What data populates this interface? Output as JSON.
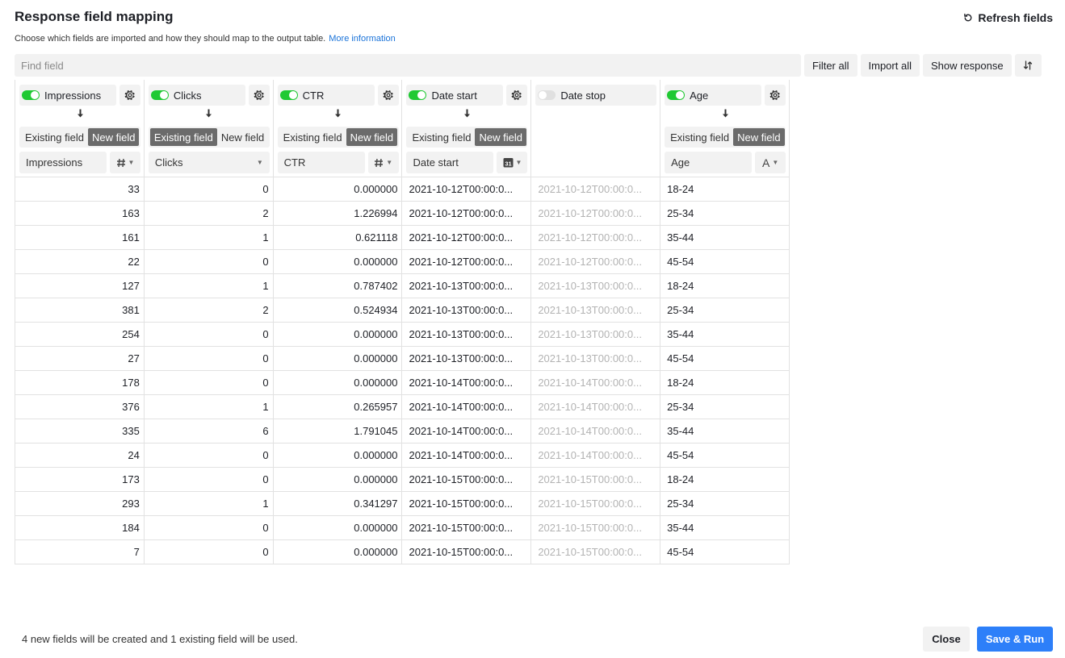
{
  "header": {
    "title": "Response field mapping",
    "refresh_label": "Refresh fields",
    "subtitle": "Choose which fields are imported and how they should map to the output table.",
    "more_info_link": "More information"
  },
  "toolbar": {
    "find_placeholder": "Find field",
    "filter_all": "Filter all",
    "import_all": "Import all",
    "show_response": "Show response"
  },
  "columns": [
    {
      "name": "Impressions",
      "enabled": true,
      "mapping": "new",
      "target": "Impressions",
      "type_icon": "hash-icon",
      "align": "right"
    },
    {
      "name": "Clicks",
      "enabled": true,
      "mapping": "existing",
      "target": "Clicks",
      "type_icon": "",
      "align": "right"
    },
    {
      "name": "CTR",
      "enabled": true,
      "mapping": "new",
      "target": "CTR",
      "type_icon": "hash-icon",
      "align": "right"
    },
    {
      "name": "Date start",
      "enabled": true,
      "mapping": "new",
      "target": "Date start",
      "type_icon": "calendar-icon",
      "align": "left"
    },
    {
      "name": "Date stop",
      "enabled": false,
      "mapping": "",
      "target": "",
      "type_icon": "",
      "align": "left"
    },
    {
      "name": "Age",
      "enabled": true,
      "mapping": "new",
      "target": "Age",
      "type_icon": "text-type-icon",
      "align": "left"
    }
  ],
  "mapping_labels": {
    "existing": "Existing field",
    "new": "New field"
  },
  "text_type_glyph": "A",
  "calendar_glyph": "31",
  "rows": [
    [
      "33",
      "0",
      "0.000000",
      "2021-10-12T00:00:0...",
      "2021-10-12T00:00:0...",
      "18-24"
    ],
    [
      "163",
      "2",
      "1.226994",
      "2021-10-12T00:00:0...",
      "2021-10-12T00:00:0...",
      "25-34"
    ],
    [
      "161",
      "1",
      "0.621118",
      "2021-10-12T00:00:0...",
      "2021-10-12T00:00:0...",
      "35-44"
    ],
    [
      "22",
      "0",
      "0.000000",
      "2021-10-12T00:00:0...",
      "2021-10-12T00:00:0...",
      "45-54"
    ],
    [
      "127",
      "1",
      "0.787402",
      "2021-10-13T00:00:0...",
      "2021-10-13T00:00:0...",
      "18-24"
    ],
    [
      "381",
      "2",
      "0.524934",
      "2021-10-13T00:00:0...",
      "2021-10-13T00:00:0...",
      "25-34"
    ],
    [
      "254",
      "0",
      "0.000000",
      "2021-10-13T00:00:0...",
      "2021-10-13T00:00:0...",
      "35-44"
    ],
    [
      "27",
      "0",
      "0.000000",
      "2021-10-13T00:00:0...",
      "2021-10-13T00:00:0...",
      "45-54"
    ],
    [
      "178",
      "0",
      "0.000000",
      "2021-10-14T00:00:0...",
      "2021-10-14T00:00:0...",
      "18-24"
    ],
    [
      "376",
      "1",
      "0.265957",
      "2021-10-14T00:00:0...",
      "2021-10-14T00:00:0...",
      "25-34"
    ],
    [
      "335",
      "6",
      "1.791045",
      "2021-10-14T00:00:0...",
      "2021-10-14T00:00:0...",
      "35-44"
    ],
    [
      "24",
      "0",
      "0.000000",
      "2021-10-14T00:00:0...",
      "2021-10-14T00:00:0...",
      "45-54"
    ],
    [
      "173",
      "0",
      "0.000000",
      "2021-10-15T00:00:0...",
      "2021-10-15T00:00:0...",
      "18-24"
    ],
    [
      "293",
      "1",
      "0.341297",
      "2021-10-15T00:00:0...",
      "2021-10-15T00:00:0...",
      "25-34"
    ],
    [
      "184",
      "0",
      "0.000000",
      "2021-10-15T00:00:0...",
      "2021-10-15T00:00:0...",
      "35-44"
    ],
    [
      "7",
      "0",
      "0.000000",
      "2021-10-15T00:00:0...",
      "2021-10-15T00:00:0...",
      "45-54"
    ]
  ],
  "footer": {
    "summary": "4 new fields will be created and 1 existing field will be used.",
    "close_label": "Close",
    "save_label": "Save & Run"
  },
  "colors": {
    "toggle_on": "#20c933",
    "primary": "#2d7ff9",
    "link": "#1a73d9",
    "active_segment": "#6b6b6b"
  }
}
